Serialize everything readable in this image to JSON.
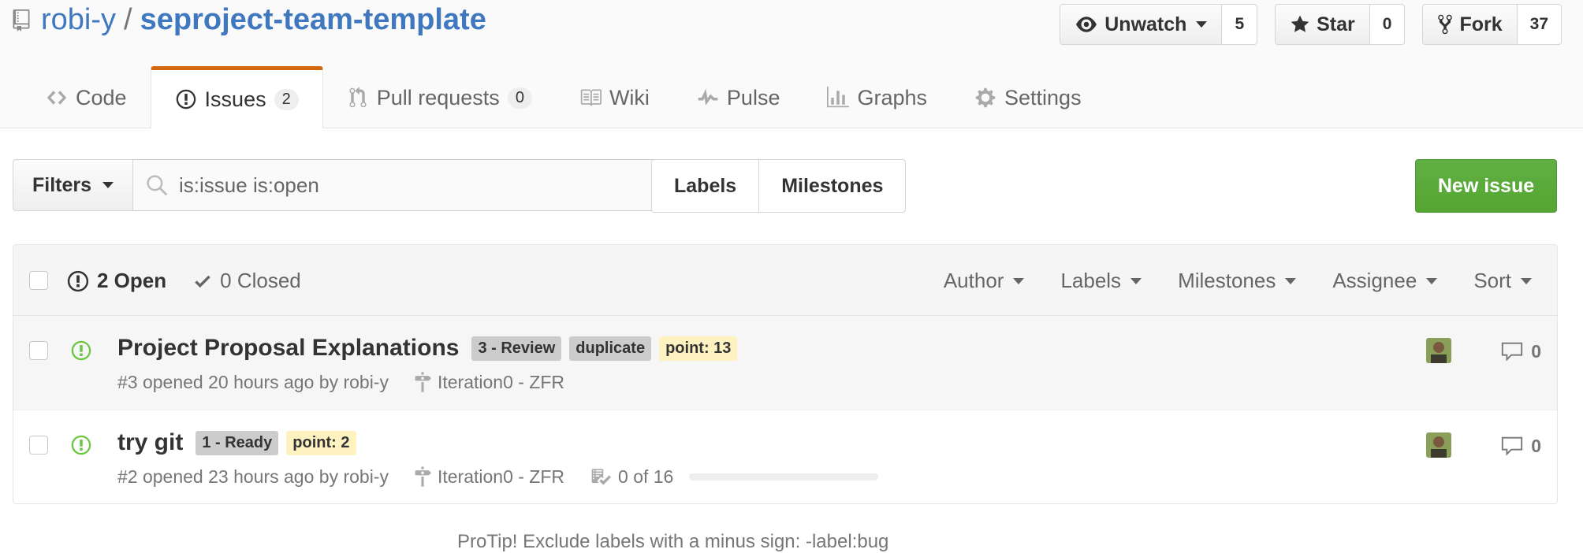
{
  "repo": {
    "owner": "robi-y",
    "separator": "/",
    "name": "seproject-team-template"
  },
  "actions": {
    "watch": {
      "label": "Unwatch",
      "count": "5"
    },
    "star": {
      "label": "Star",
      "count": "0"
    },
    "fork": {
      "label": "Fork",
      "count": "37"
    }
  },
  "tabs": [
    {
      "label": "Code",
      "icon": "code-icon"
    },
    {
      "label": "Issues",
      "icon": "issue-opened-icon",
      "counter": "2",
      "active": true
    },
    {
      "label": "Pull requests",
      "icon": "pull-request-icon",
      "counter": "0"
    },
    {
      "label": "Wiki",
      "icon": "book-icon"
    },
    {
      "label": "Pulse",
      "icon": "pulse-icon"
    },
    {
      "label": "Graphs",
      "icon": "graph-icon"
    },
    {
      "label": "Settings",
      "icon": "gear-icon"
    }
  ],
  "filters": {
    "button": "Filters",
    "search_value": "is:issue is:open"
  },
  "labels_button": "Labels",
  "milestones_button": "Milestones",
  "new_issue_button": "New issue",
  "table_header": {
    "open": "2 Open",
    "closed": "0 Closed",
    "sort_menus": [
      "Author",
      "Labels",
      "Milestones",
      "Assignee",
      "Sort"
    ]
  },
  "issues": [
    {
      "title": "Project Proposal Explanations",
      "labels": [
        {
          "text": "3 - Review",
          "bg": "#cccccc"
        },
        {
          "text": "duplicate",
          "bg": "#cccccc"
        },
        {
          "text": "point: 13",
          "bg": "#fef2c0"
        }
      ],
      "meta": "#3 opened 20 hours ago by robi-y",
      "milestone": "Iteration0 - ZFR",
      "comments": "0"
    },
    {
      "title": "try git",
      "labels": [
        {
          "text": "1 - Ready",
          "bg": "#cccccc"
        },
        {
          "text": "point: 2",
          "bg": "#fef2c0"
        }
      ],
      "meta": "#2 opened 23 hours ago by robi-y",
      "milestone": "Iteration0 - ZFR",
      "tasks": "0 of 16",
      "tasks_progress": 0,
      "comments": "0"
    }
  ],
  "footer": {
    "text": "ProTip! Exclude labels with a minus sign: -label:bug"
  },
  "colors": {
    "link": "#4078c0",
    "active_tab_border": "#d26911",
    "open_status": "#6cc644",
    "new_issue_green": "#55a532"
  }
}
